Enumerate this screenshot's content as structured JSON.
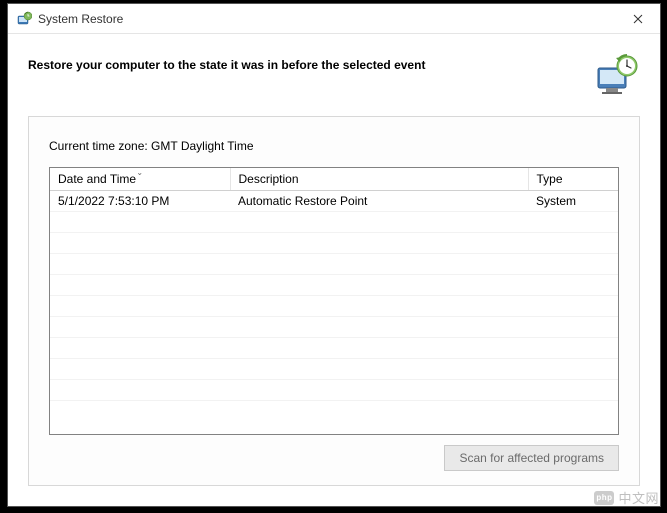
{
  "window": {
    "title": "System Restore"
  },
  "header": {
    "heading": "Restore your computer to the state it was in before the selected event"
  },
  "timezone": {
    "label": "Current time zone: GMT Daylight Time"
  },
  "table": {
    "columns": {
      "datetime": "Date and Time",
      "description": "Description",
      "type": "Type"
    },
    "rows": [
      {
        "datetime": "5/1/2022 7:53:10 PM",
        "description": "Automatic Restore Point",
        "type": "System"
      }
    ]
  },
  "buttons": {
    "scan": "Scan for affected programs"
  },
  "watermark": {
    "text": "中文网",
    "logo": "php"
  }
}
